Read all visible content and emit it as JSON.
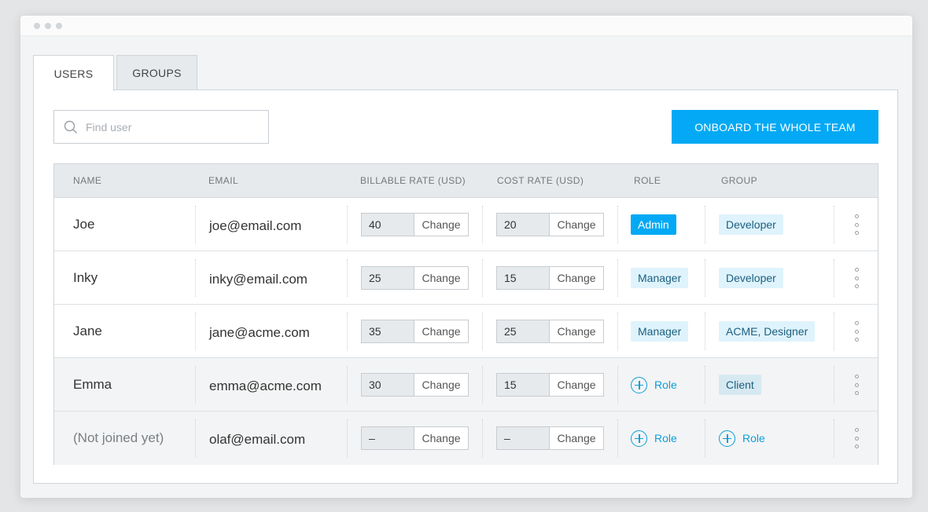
{
  "window": {
    "tabs": [
      {
        "label": "USERS",
        "active": true
      },
      {
        "label": "GROUPS",
        "active": false
      }
    ]
  },
  "toolbar": {
    "search_placeholder": "Find user",
    "onboard_label": "ONBOARD THE WHOLE TEAM"
  },
  "colors": {
    "accent": "#03a9f4",
    "badge_bg": "#dff3fc",
    "badge_text": "#1a5f7f"
  },
  "table": {
    "headers": {
      "name": "NAME",
      "email": "EMAIL",
      "billable_rate": "BILLABLE RATE (USD)",
      "cost_rate": "COST RATE (USD)",
      "role": "ROLE",
      "group": "GROUP"
    },
    "change_label": "Change",
    "add_role_label": "Role",
    "rows": [
      {
        "name": "Joe",
        "email": "joe@email.com",
        "billable": "40",
        "cost": "20",
        "role": "Admin",
        "group": "Developer"
      },
      {
        "name": "Inky",
        "email": "inky@email.com",
        "billable": "25",
        "cost": "15",
        "role": "Manager",
        "group": "Developer"
      },
      {
        "name": "Jane",
        "email": "jane@acme.com",
        "billable": "35",
        "cost": "25",
        "role": "Manager",
        "group": "ACME, Designer"
      },
      {
        "name": "Emma",
        "email": "emma@acme.com",
        "billable": "30",
        "cost": "15",
        "role": "",
        "group": "Client"
      },
      {
        "name": "(Not joined yet)",
        "email": "olaf@email.com",
        "billable": "–",
        "cost": "–",
        "role": "",
        "group": ""
      }
    ]
  }
}
